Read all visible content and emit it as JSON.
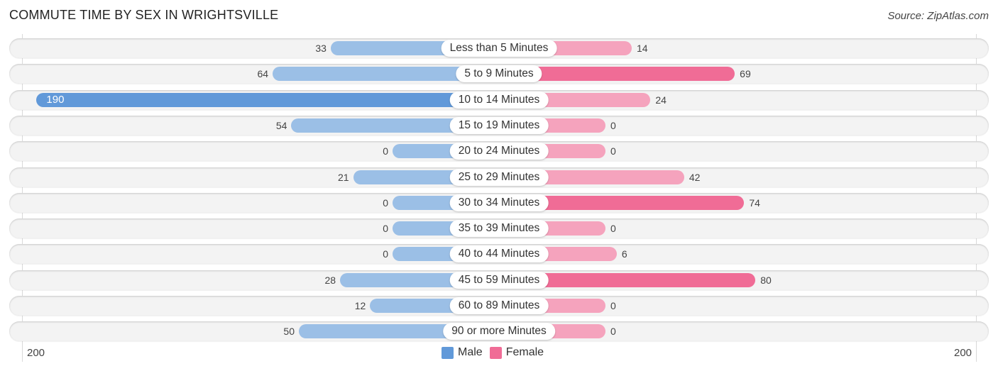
{
  "title": "COMMUTE TIME BY SEX IN WRIGHTSVILLE",
  "source": "Source: ZipAtlas.com",
  "colors": {
    "male": "#9bbfe6",
    "male_highlight": "#6199d9",
    "female": "#f5a3bd",
    "female_highlight": "#f06c96"
  },
  "chart_data": {
    "type": "bar",
    "orientation": "horizontal-diverging",
    "title": "COMMUTE TIME BY SEX IN WRIGHTSVILLE",
    "categories": [
      "Less than 5 Minutes",
      "5 to 9 Minutes",
      "10 to 14 Minutes",
      "15 to 19 Minutes",
      "20 to 24 Minutes",
      "25 to 29 Minutes",
      "30 to 34 Minutes",
      "35 to 39 Minutes",
      "40 to 44 Minutes",
      "45 to 59 Minutes",
      "60 to 89 Minutes",
      "90 or more Minutes"
    ],
    "series": [
      {
        "name": "Male",
        "values": [
          33,
          64,
          190,
          54,
          0,
          21,
          0,
          0,
          0,
          28,
          12,
          50
        ]
      },
      {
        "name": "Female",
        "values": [
          14,
          69,
          24,
          0,
          0,
          42,
          74,
          0,
          6,
          80,
          0,
          0
        ]
      }
    ],
    "axis": {
      "left_tick": "200",
      "right_tick": "200",
      "max": 200
    },
    "legend": {
      "position": "bottom-center",
      "entries": [
        "Male",
        "Female"
      ]
    },
    "grid": false
  }
}
